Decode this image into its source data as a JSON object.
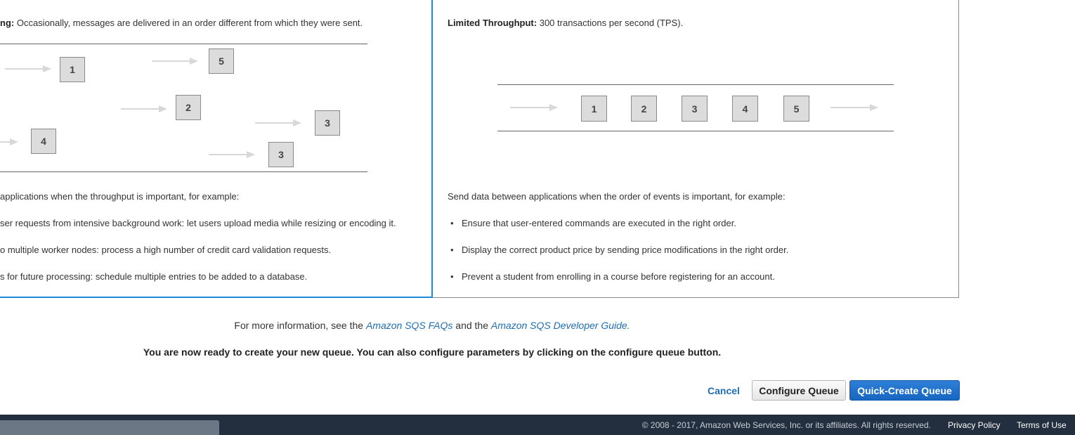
{
  "standard_queue": {
    "ordering_heading": "ng:",
    "ordering_text": "Occasionally, messages are delivered in an order different from which they were sent.",
    "diagram_boxes": [
      "1",
      "5",
      "2",
      "3",
      "4",
      "3"
    ],
    "use_intro": "applications when the throughput is important, for example:",
    "bullets": [
      "ser requests from intensive background work: let users upload media while resizing or encoding it.",
      "o multiple worker nodes: process a high number of credit card validation requests.",
      "s for future processing: schedule multiple entries to be added to a database."
    ]
  },
  "fifo_queue": {
    "throughput_heading": "Limited Throughput:",
    "throughput_text": "300 transactions per second (TPS).",
    "diagram_boxes": [
      "1",
      "2",
      "3",
      "4",
      "5"
    ],
    "use_intro": "Send data between applications when the order of events is important, for example:",
    "bullets": [
      "Ensure that user-entered commands are executed in the right order.",
      "Display the correct product price by sending price modifications in the right order.",
      "Prevent a student from enrolling in a course before registering for an account."
    ]
  },
  "info": {
    "prefix": "For more information, see the",
    "faq_link": "Amazon SQS FAQs",
    "middle": "and the",
    "guide_link": "Amazon SQS Developer Guide."
  },
  "ready_text": "You are now ready to create your new queue. You can also configure parameters by clicking on the configure queue button.",
  "actions": {
    "cancel": "Cancel",
    "configure": "Configure Queue",
    "quick_create": "Quick-Create Queue"
  },
  "footer": {
    "copyright": "© 2008 - 2017, Amazon Web Services, Inc. or its affiliates. All rights reserved.",
    "privacy": "Privacy Policy",
    "terms": "Terms of Use"
  },
  "colors": {
    "selected_border": "#1a8ad6",
    "primary_button": "#1766c2",
    "link": "#1f6db2",
    "footer_bg": "#232f3e"
  }
}
